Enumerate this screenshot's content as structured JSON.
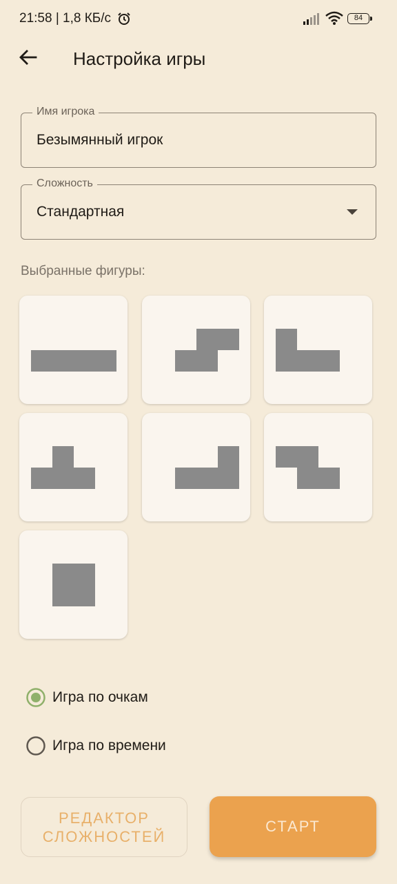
{
  "status_bar": {
    "time_speed": "21:58 | 1,8 КБ/с",
    "battery": "84"
  },
  "app_bar": {
    "title": "Настройка игры"
  },
  "player_name": {
    "label": "Имя игрока",
    "value": "Безымянный игрок"
  },
  "difficulty": {
    "label": "Сложность",
    "value": "Стандартная"
  },
  "figures": {
    "label": "Выбранные фигуры:",
    "items": [
      "I",
      "S",
      "J",
      "T",
      "L",
      "Z",
      "O"
    ],
    "block_color": "#8a8a8a"
  },
  "game_mode": {
    "options": [
      "Игра по очкам",
      "Игра по времени"
    ],
    "selected": "Игра по очкам"
  },
  "buttons": {
    "editor_line1": "РЕДАКТОР",
    "editor_line2": "СЛОЖНОСТЕЙ",
    "start": "СТАРТ"
  },
  "colors": {
    "background": "#f5ebd9",
    "accent": "#eba24e",
    "radio_selected": "#8fb06a"
  }
}
